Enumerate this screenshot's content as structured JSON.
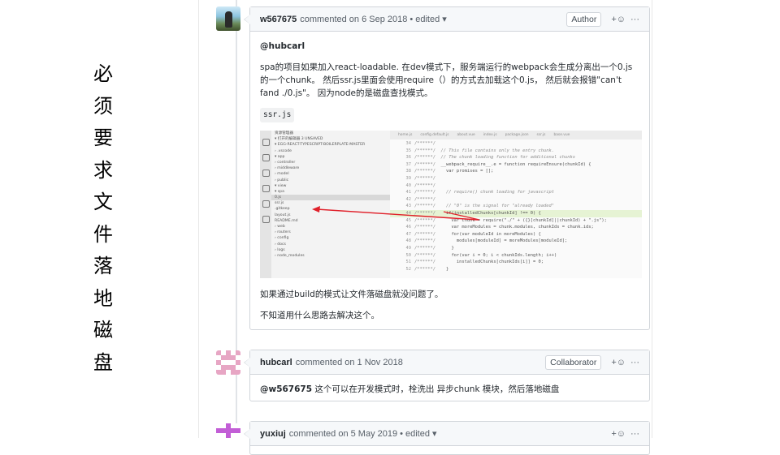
{
  "side_title": [
    "必",
    "须",
    "要",
    "求",
    "文",
    "件",
    "落",
    "地",
    "磁",
    "盘"
  ],
  "comments": [
    {
      "author": "w567675",
      "meta": "commented on 6 Sep 2018",
      "edited": "edited",
      "role": "Author",
      "mention": "@hubcarl",
      "paragraph1": "spa的项目如果加入react-loadable. 在dev模式下，服务端运行的webpack会生成分离出一个0.js的一个chunk。 然后ssr.js里面会使用require（）的方式去加载这个0.js， 然后就会报错\"can't fand ./0.js\"。 因为node的是磁盘查找模式。",
      "file_tag": "ssr.js",
      "paragraph2": "如果通过build的模式让文件落磁盘就没问题了。",
      "paragraph3": "不知道用什么思路去解决这个。"
    },
    {
      "author": "hubcarl",
      "meta": "commented on 1 Nov 2018",
      "role": "Collaborator",
      "mention": "@w567675",
      "text": " 这个可以在开发模式时，栓洗出 异步chunk 模块，然后落地磁盘"
    },
    {
      "author": "yuxiuj",
      "meta": "commented on 5 May 2019",
      "edited": "edited"
    }
  ],
  "header_icons": {
    "reaction": "+☺",
    "more": "···",
    "caret": "▾"
  },
  "editor": {
    "tabs": [
      "home.js",
      "config.default.js",
      "about.vue",
      "index.js",
      "package.json",
      "ssr.js",
      "base.vue"
    ],
    "sidebar": [
      "资源管理器",
      "▾ 打开的编辑器  3 UNSAVED",
      "▾ EGG-REACT-TYPESCRIPT-BOILERPLATE-MASTER",
      "  › .vscode",
      "  ▾ app",
      "    › controller",
      "    › middleware",
      "    › model",
      "    › public",
      "    ▾ view",
      "      ▾ spa",
      "        0.js",
      "        ssr.js",
      "    .gitkeep",
      "    layout.js",
      "    README.md",
      "    › web",
      "  › routers",
      "  › config",
      "  › docs",
      "  › logs",
      "  › node_modules"
    ],
    "lines": [
      {
        "n": "34",
        "t": "/******/",
        "c": ""
      },
      {
        "n": "35",
        "t": "/******/",
        "c": "  // This file contains only the entry chunk."
      },
      {
        "n": "36",
        "t": "/******/",
        "c": "  // The chunk loading function for additional chunks"
      },
      {
        "n": "37",
        "t": "/******/",
        "c": "  __webpack_require__.e = function requireEnsure(chunkId) {"
      },
      {
        "n": "38",
        "t": "/******/",
        "c": "    var promises = [];"
      },
      {
        "n": "39",
        "t": "/******/",
        "c": ""
      },
      {
        "n": "40",
        "t": "/******/",
        "c": ""
      },
      {
        "n": "41",
        "t": "/******/",
        "c": "    // require() chunk loading for javascript"
      },
      {
        "n": "42",
        "t": "/******/",
        "c": ""
      },
      {
        "n": "43",
        "t": "/******/",
        "c": "    // \"0\" is the signal for \"already loaded\""
      },
      {
        "n": "44",
        "t": "/******/",
        "c": "    if(installedChunks[chunkId] !== 0) {"
      },
      {
        "n": "45",
        "t": "/******/",
        "c": "      var chunk = require(\"./\" + ({}[chunkId]||chunkId) + \".js\");"
      },
      {
        "n": "46",
        "t": "/******/",
        "c": "      var moreModules = chunk.modules, chunkIds = chunk.ids;"
      },
      {
        "n": "47",
        "t": "/******/",
        "c": "      for(var moduleId in moreModules) {"
      },
      {
        "n": "48",
        "t": "/******/",
        "c": "        modules[moduleId] = moreModules[moduleId];"
      },
      {
        "n": "49",
        "t": "/******/",
        "c": "      }"
      },
      {
        "n": "50",
        "t": "/******/",
        "c": "      for(var i = 0; i < chunkIds.length; i++)"
      },
      {
        "n": "51",
        "t": "/******/",
        "c": "        installedChunks[chunkIds[i]] = 0;"
      },
      {
        "n": "52",
        "t": "/******/",
        "c": "    }"
      }
    ]
  },
  "colors": {
    "accent": "#0366d6",
    "border": "#d1d5da",
    "header_bg": "#f6f8fa",
    "arrow": "#e0202a",
    "highlight": "#e6f3d4"
  }
}
